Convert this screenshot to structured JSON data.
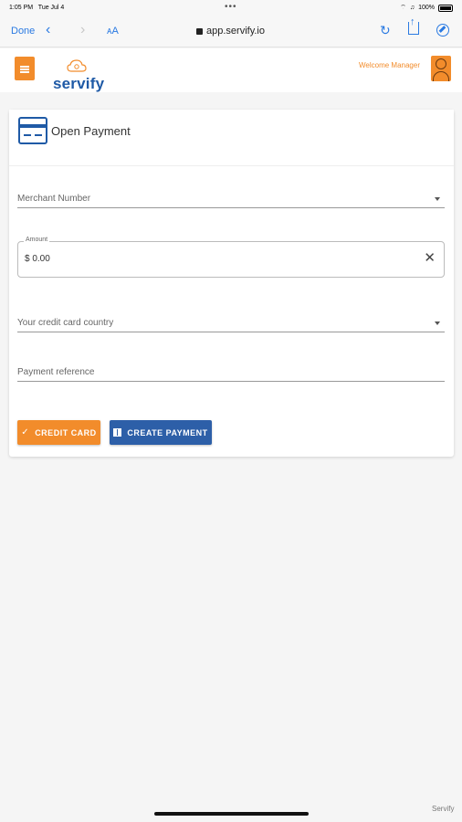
{
  "status_bar": {
    "time": "1:05 PM",
    "date": "Tue Jul 4",
    "battery": "100%"
  },
  "browser": {
    "done_label": "Done",
    "text_size_label": "ᴀA",
    "url": "app.servify.io"
  },
  "header": {
    "brand": "servify",
    "welcome_text": "Welcome Manager"
  },
  "card": {
    "title": "Open Payment",
    "fields": {
      "merchant_number_label": "Merchant Number",
      "amount_label": "Amount",
      "amount_value": "$ 0.00",
      "country_label": "Your credit card country",
      "reference_label": "Payment reference"
    },
    "buttons": {
      "credit_card": "CREDIT CARD",
      "create_payment": "CREATE PAYMENT"
    }
  },
  "footer": {
    "brand": "Servify"
  },
  "colors": {
    "accent_orange": "#f28c2b",
    "brand_blue": "#1f5aa6",
    "button_blue": "#2d5fa8"
  }
}
